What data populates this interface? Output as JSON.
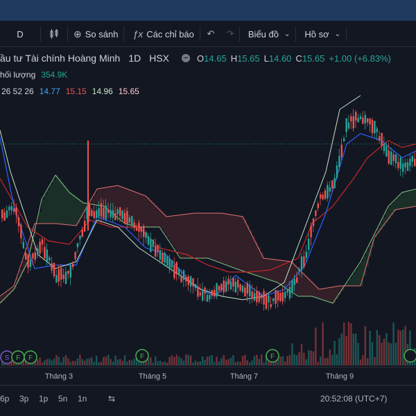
{
  "toolbar": {
    "interval": "D",
    "compare": "So sánh",
    "indicators": "Các chỉ báo",
    "chart_menu": "Biểu đồ",
    "profile_menu": "Hồ sơ"
  },
  "symbol": {
    "name": "ầu tư Tài chính Hoàng Minh",
    "interval": "1D",
    "exchange": "HSX",
    "o_label": "O",
    "o": "14.65",
    "h_label": "H",
    "h": "15.65",
    "l_label": "L",
    "l": "14.60",
    "c_label": "C",
    "c": "15.65",
    "change": "+1.00 (+6.83%)"
  },
  "volume": {
    "label": "hối lượng",
    "value": "354.9K"
  },
  "ichimoku": {
    "params": "26 52 26",
    "v1": "14.77",
    "v2": "15.15",
    "v3": "14.96",
    "v4": "15.65"
  },
  "colors": {
    "up": "#26a69a",
    "down": "#ef5350",
    "accent_green": "#22ab94",
    "conversion": "#2962ff",
    "base": "#b71c1c",
    "lagging": "#43a047"
  },
  "event_markers": [
    "S",
    "F",
    "F",
    "F",
    "F"
  ],
  "time_axis": [
    "Tháng 3",
    "Tháng 5",
    "Tháng 7",
    "Tháng 9"
  ],
  "bottom": {
    "ranges": [
      "6p",
      "3p",
      "1p",
      "5n",
      "1n"
    ],
    "clock": "20:52:08 (UTC+7)"
  }
}
